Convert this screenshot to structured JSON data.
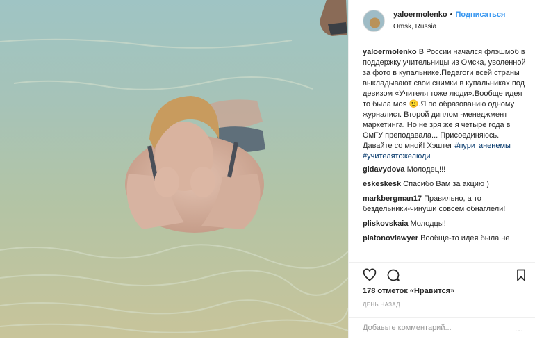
{
  "post": {
    "username": "yaloermolenko",
    "separator": "•",
    "follow_label": "Подписаться",
    "location": "Omsk, Russia"
  },
  "caption": {
    "username": "yaloermolenko",
    "text": "В России начался флэшмоб в поддержку учительницы из Омска, уволенной за фото в купальнике.Педагоги всей страны выкладывают свои снимки в купальниках под девизом «Учителя тоже люди».Вообще идея то была моя 🙂.Я по образованию одному журналист. Второй диплом -менеджмент маркетинга. Но не зря же я четыре года в ОмГУ преподавала... Присоединяюсь. Давайте со мной! Хэштег ",
    "hashtag1": "#пуританенемы",
    "hashtag2": "#учителятожелюди"
  },
  "comments": [
    {
      "user": "gidavydova",
      "text": "Молодец!!!"
    },
    {
      "user": "eskeskesk",
      "text": "Спасибо Вам за акцию )"
    },
    {
      "user": "markbergman17",
      "text": "Правильно, а то бездельники-чинуши совсем обнаглели!"
    },
    {
      "user": "pliskovskaia",
      "text": "Молодцы!"
    },
    {
      "user": "platonovlawyer",
      "text": "Вообще-то идея была не"
    }
  ],
  "actions": {
    "like_icon": "heart-icon",
    "comment_icon": "comment-icon",
    "save_icon": "bookmark-icon"
  },
  "likes_text": "178 отметок «Нравится»",
  "date_text": "ДЕНЬ НАЗАД",
  "add_comment_placeholder": "Добавьте комментарий...",
  "more_label": "..."
}
